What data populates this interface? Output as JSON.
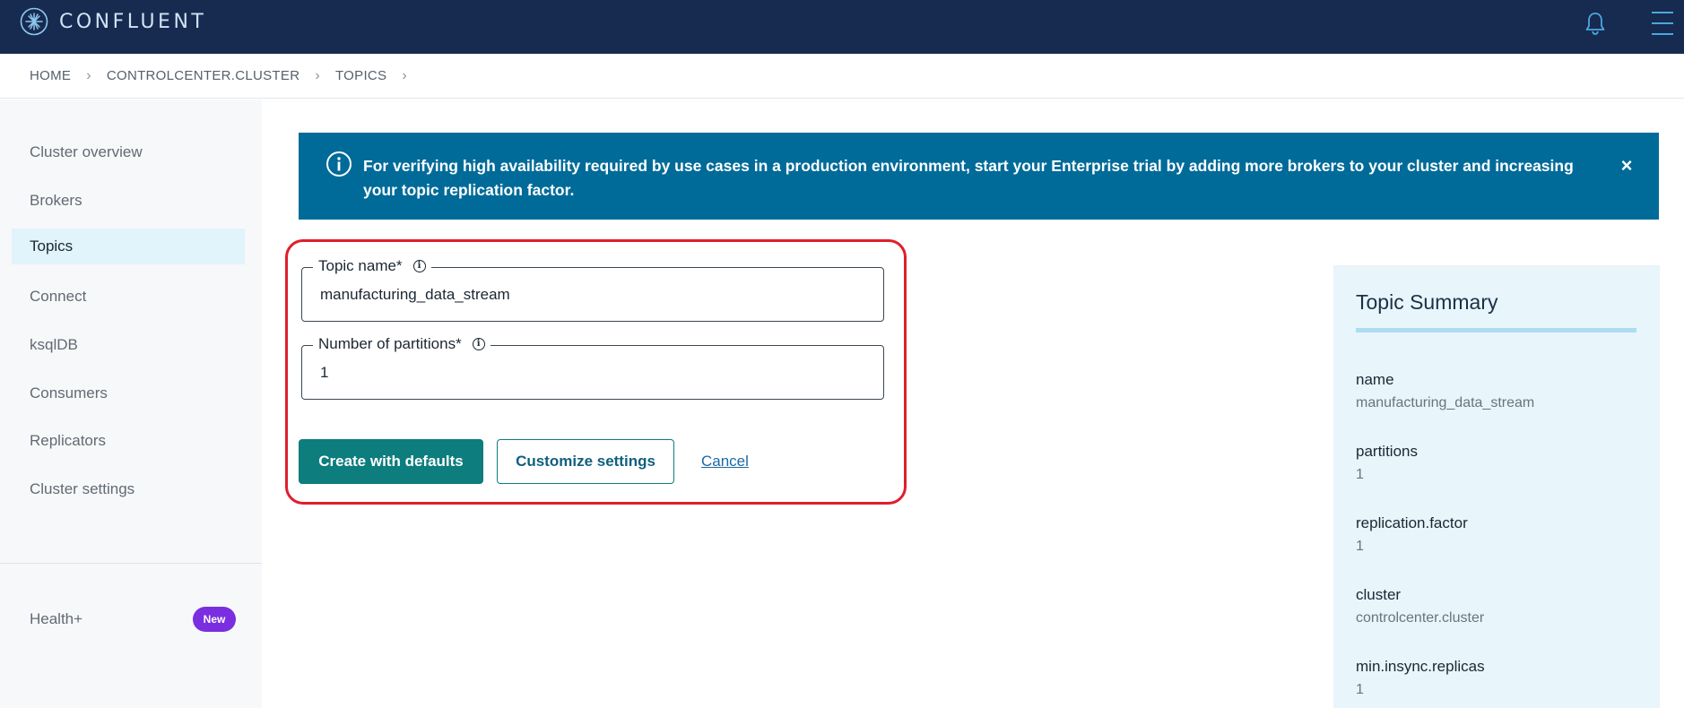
{
  "header": {
    "brand": "CONFLUENT",
    "brand_color": "#172a4f"
  },
  "breadcrumb": {
    "items": [
      "HOME",
      "CONTROLCENTER.CLUSTER",
      "TOPICS"
    ],
    "separator": "›"
  },
  "sidebar": {
    "items": [
      {
        "label": "Cluster overview",
        "active": false
      },
      {
        "label": "Brokers",
        "active": false
      },
      {
        "label": "Topics",
        "active": true
      },
      {
        "label": "Connect",
        "active": false
      },
      {
        "label": "ksqlDB",
        "active": false
      },
      {
        "label": "Consumers",
        "active": false
      },
      {
        "label": "Replicators",
        "active": false
      },
      {
        "label": "Cluster settings",
        "active": false
      }
    ],
    "health_label": "Health+",
    "health_badge": "New"
  },
  "banner": {
    "text": "For verifying high availability required by use cases in a production environment, start your Enterprise trial by adding more brokers to your cluster and increasing your topic replication factor.",
    "close": "×"
  },
  "form": {
    "topic_name_label": "Topic name*",
    "topic_name_value": "manufacturing_data_stream",
    "partitions_label": "Number of partitions*",
    "partitions_value": "1",
    "create_label": "Create with defaults",
    "customize_label": "Customize settings",
    "cancel_label": "Cancel"
  },
  "summary": {
    "title": "Topic Summary",
    "rows": [
      {
        "label": "name",
        "value": "manufacturing_data_stream"
      },
      {
        "label": "partitions",
        "value": "1"
      },
      {
        "label": "replication.factor",
        "value": "1"
      },
      {
        "label": "cluster",
        "value": "controlcenter.cluster"
      },
      {
        "label": "min.insync.replicas",
        "value": "1"
      }
    ]
  }
}
